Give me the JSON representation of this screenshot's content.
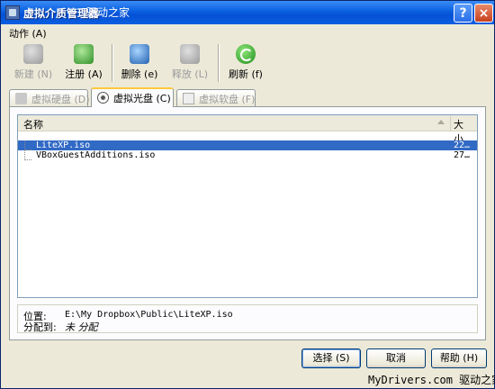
{
  "window": {
    "title": "虚拟介质管理器",
    "watermark_top": "驱动之家",
    "help_glyph": "?",
    "close_glyph": "×"
  },
  "menu": {
    "action": "动作 (A)"
  },
  "toolbar": {
    "new": "新建 (N)",
    "register": "注册 (A)",
    "remove": "删除 (e)",
    "release": "释放 (L)",
    "refresh": "刷新 (f)"
  },
  "tabs": {
    "hard_disk": "虚拟硬盘 (D)",
    "cd_dvd": "虚拟光盘 (C)",
    "floppy": "虚拟软盘 (F)"
  },
  "list": {
    "col_name": "名称",
    "col_size": "大小",
    "rows": [
      {
        "name": "LiteXP.iso",
        "size": "22…"
      },
      {
        "name": "VBoxGuestAdditions.iso",
        "size": "27…"
      }
    ]
  },
  "info": {
    "location_label": "位置:",
    "location_value": "E:\\My Dropbox\\Public\\LiteXP.iso",
    "attached_label": "分配到:",
    "attached_value": "未 分配"
  },
  "buttons": {
    "select": "选择 (S)",
    "cancel": "取消",
    "help": "帮助 (H)"
  },
  "footer_watermark": "MyDrivers.com 驱动之家",
  "icons": {
    "new": "disk-new-icon",
    "register": "disk-register-icon",
    "remove": "disk-remove-icon",
    "release": "disk-release-icon",
    "refresh": "refresh-icon"
  }
}
